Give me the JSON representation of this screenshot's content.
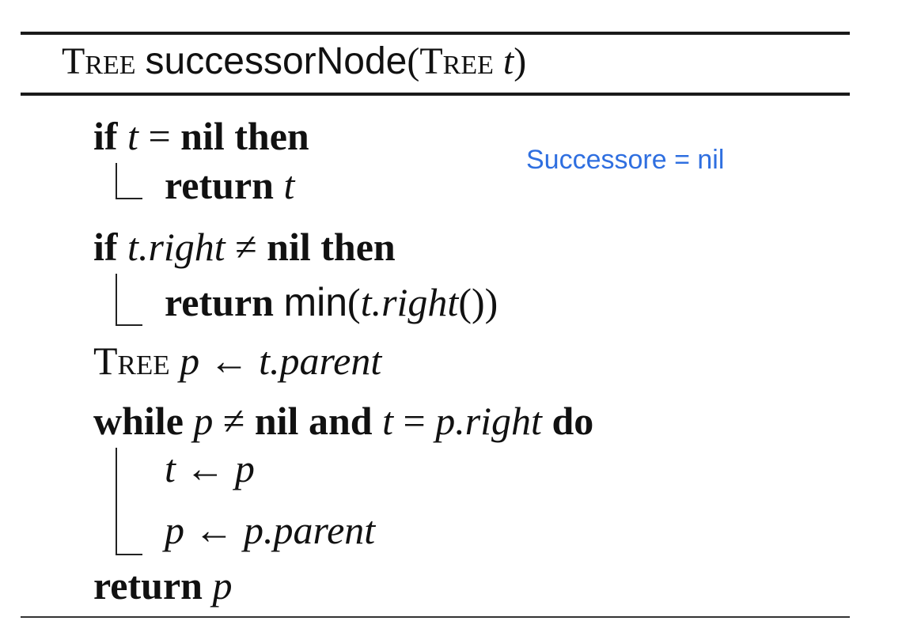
{
  "header": {
    "return_type": "Tree",
    "func_name": "successorNode",
    "open_paren": "(",
    "param_type": "Tree",
    "param_name": "t",
    "close_paren": ")"
  },
  "lines": {
    "l1": {
      "kw_if": "if",
      "var": "t",
      "op": "=",
      "kw_nil": "nil",
      "kw_then": "then"
    },
    "l2": {
      "kw_return": "return",
      "var": "t"
    },
    "l3": {
      "kw_if": "if",
      "var": "t.right",
      "op": "≠",
      "kw_nil": "nil",
      "kw_then": "then"
    },
    "l4": {
      "kw_return": "return",
      "fn": "min",
      "open": "(",
      "arg": "t.right",
      "call": "()",
      "close": ")"
    },
    "l5": {
      "type": "Tree",
      "var": "p",
      "arrow": "←",
      "expr": "t.parent"
    },
    "l6": {
      "kw_while": "while",
      "var": "p",
      "op": "≠",
      "kw_nil": "nil",
      "kw_and": "and",
      "var2": "t",
      "op2": "=",
      "expr": "p.right",
      "kw_do": "do"
    },
    "l7": {
      "var": "t",
      "arrow": "←",
      "expr": "p"
    },
    "l8": {
      "var": "p",
      "arrow": "←",
      "expr": "p.parent"
    },
    "l9": {
      "kw_return": "return",
      "var": "p"
    }
  },
  "annotation": {
    "text": "Successore = nil"
  },
  "colors": {
    "annotation": "#2f6fe0",
    "text": "#111111"
  }
}
